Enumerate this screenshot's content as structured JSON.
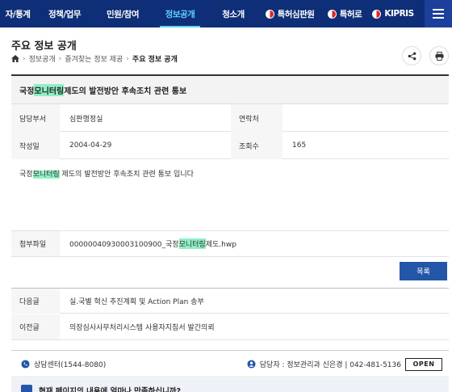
{
  "topnav": {
    "items": [
      {
        "label": "자/통계",
        "active": false
      },
      {
        "label": "정책/업무",
        "active": false
      },
      {
        "label": "민원/참여",
        "active": false
      },
      {
        "label": "정보공개",
        "active": true
      },
      {
        "label": "청소개",
        "active": false
      }
    ],
    "external": [
      {
        "label": "특허심판원",
        "icon": "kipo-logo-icon"
      },
      {
        "label": "특허로",
        "icon": "kipo-logo-icon"
      },
      {
        "label": "KIPRIS",
        "icon": "kipo-logo-icon"
      }
    ],
    "menu_icon": "hamburger-icon"
  },
  "header": {
    "title": "주요 정보 공개",
    "breadcrumb": [
      "정보공개",
      "즐겨찾는 정보 제공",
      "주요 정보 공개"
    ]
  },
  "article": {
    "title_prefix": "국정",
    "title_highlight": "모니터링",
    "title_suffix": " 제도의 발전방안 후속조치 관련 통보",
    "department_label": "담당부서",
    "department": "심판행정실",
    "contact_label": "연락처",
    "contact": "",
    "date_label": "작성일",
    "date": "2004-04-29",
    "views_label": "조회수",
    "views": "165",
    "body_prefix": "국정",
    "body_highlight": "모니터링",
    "body_suffix": " 제도의 발전방안 후속조치 관련 통보 입니다",
    "attachment_label": "첨부파일",
    "attachment_prefix": "0000004093000310090​0_국정",
    "attachment_highlight": "모니터링",
    "attachment_suffix": "제도.hwp"
  },
  "list_button": "목록",
  "navigation": {
    "next_label": "다음글",
    "next_title": "실.국별 혁신 추진계획 및 Action Plan 송부",
    "prev_label": "이전글",
    "prev_title": "의장심사사무처리시스템 사용자지침서 발간의뢰"
  },
  "footer": {
    "call_center": "상담센터(1544-8080)",
    "manager": "담당자 : 정보관리과 신은경 | 042-481-5136",
    "open_badge": "OPEN",
    "survey_text": "현재 페이지의 내용에 얼마나 만족하십니까?"
  },
  "colors": {
    "nav_bg": "#0e2e77",
    "nav_active": "#5fd3ff",
    "highlight": "#8ff0c4",
    "button_bg": "#2456a8"
  }
}
